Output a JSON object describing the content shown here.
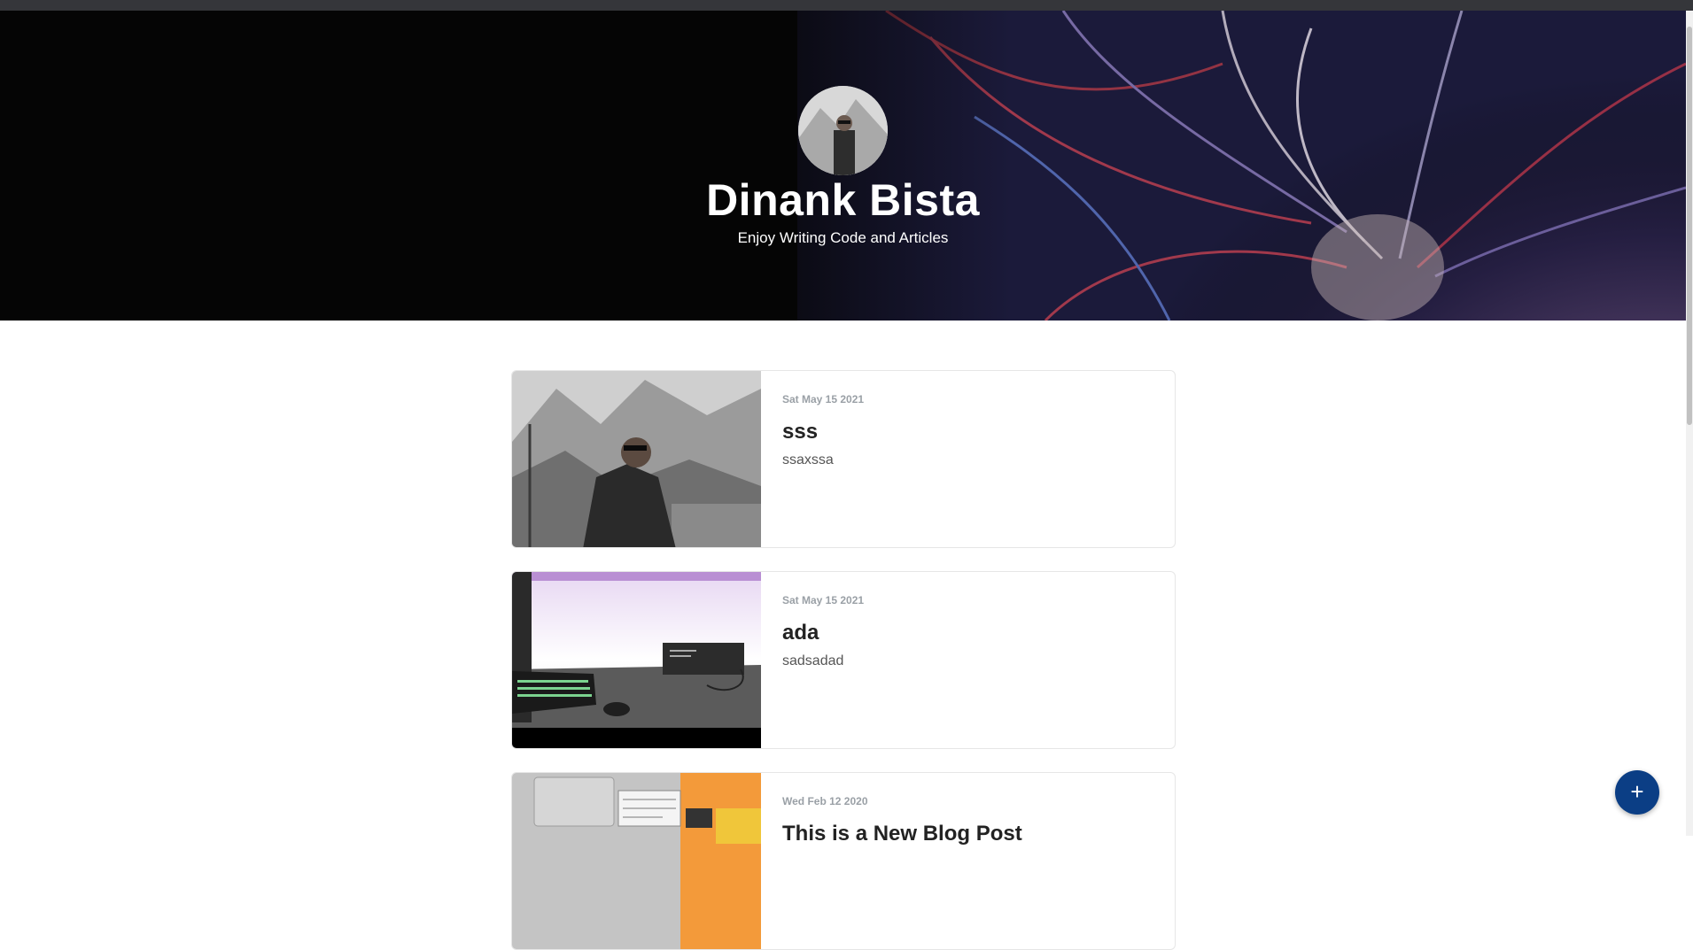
{
  "profile": {
    "name": "Dinank Bista",
    "tagline": "Enjoy Writing Code and Articles",
    "avatar_icon": "avatar-photo"
  },
  "posts": [
    {
      "date": "Sat May 15 2021",
      "title": "sss",
      "excerpt": "ssaxssa",
      "thumbnail": "mountain-portrait"
    },
    {
      "date": "Sat May 15 2021",
      "title": "ada",
      "excerpt": "sadsadad",
      "thumbnail": "desk-keyboard"
    },
    {
      "date": "Wed Feb 12 2020",
      "title": "This is a New Blog Post",
      "excerpt": "",
      "thumbnail": "laptop-ux-store"
    }
  ],
  "fab": {
    "label": "+",
    "icon": "plus-icon"
  },
  "colors": {
    "hero_bg": "#050505",
    "fab_bg": "#0b3e85",
    "date_text": "#9aa0a6",
    "title_text": "#222222"
  }
}
